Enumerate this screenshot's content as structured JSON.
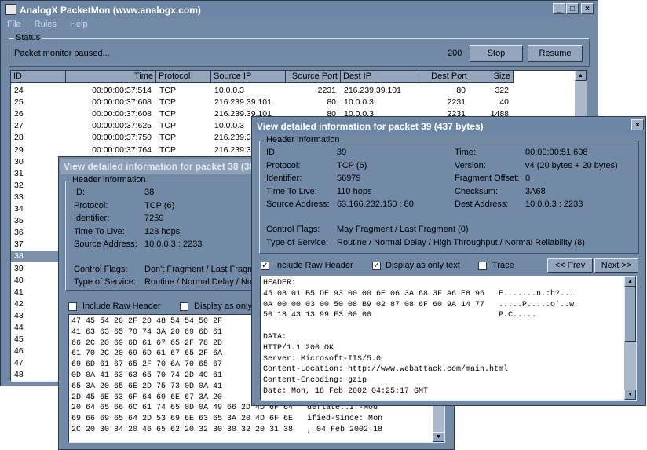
{
  "main": {
    "title": "AnalogX PacketMon (www.analogx.com)",
    "menu": [
      "File",
      "Rules",
      "Help"
    ],
    "status_label": "Status",
    "status_text": "Packet monitor paused...",
    "count": "200",
    "stop": "Stop",
    "resume": "Resume",
    "columns": [
      "ID",
      "Time",
      "Protocol",
      "Source IP",
      "Source Port",
      "Dest IP",
      "Dest Port",
      "Size"
    ],
    "rows": [
      [
        "24",
        "00:00:00:37:514",
        "TCP",
        "10.0.0.3",
        "2231",
        "216.239.39.101",
        "80",
        "322"
      ],
      [
        "25",
        "00:00:00:37:608",
        "TCP",
        "216.239.39.101",
        "80",
        "10.0.0.3",
        "2231",
        "40"
      ],
      [
        "26",
        "00:00:00:37:608",
        "TCP",
        "216.239.39.101",
        "80",
        "10.0.0.3",
        "2231",
        "1488"
      ],
      [
        "27",
        "00:00:00:37:625",
        "TCP",
        "10.0.0.3",
        "",
        "",
        "",
        ""
      ],
      [
        "28",
        "00:00:00:37:750",
        "TCP",
        "216.239.3",
        "",
        "",
        "",
        ""
      ],
      [
        "29",
        "00:00:00:37:764",
        "TCP",
        "216.239.3",
        "",
        "",
        "",
        ""
      ],
      [
        "30",
        "",
        "",
        "",
        "",
        "",
        "",
        ""
      ],
      [
        "31",
        "",
        "",
        "",
        "",
        "",
        "",
        ""
      ],
      [
        "32",
        "",
        "",
        "",
        "",
        "",
        "",
        ""
      ],
      [
        "33",
        "",
        "",
        "",
        "",
        "",
        "",
        ""
      ],
      [
        "34",
        "",
        "",
        "",
        "",
        "",
        "",
        ""
      ],
      [
        "35",
        "",
        "",
        "",
        "",
        "",
        "",
        ""
      ],
      [
        "36",
        "",
        "",
        "",
        "",
        "",
        "",
        ""
      ],
      [
        "37",
        "",
        "",
        "",
        "",
        "",
        "",
        ""
      ],
      [
        "38",
        "",
        "",
        "",
        "",
        "",
        "",
        ""
      ],
      [
        "39",
        "",
        "",
        "",
        "",
        "",
        "",
        ""
      ],
      [
        "40",
        "",
        "",
        "",
        "",
        "",
        "",
        ""
      ],
      [
        "41",
        "",
        "",
        "",
        "",
        "",
        "",
        ""
      ],
      [
        "42",
        "",
        "",
        "",
        "",
        "",
        "",
        ""
      ],
      [
        "43",
        "",
        "",
        "",
        "",
        "",
        "",
        ""
      ],
      [
        "44",
        "",
        "",
        "",
        "",
        "",
        "",
        ""
      ],
      [
        "45",
        "",
        "",
        "",
        "",
        "",
        "",
        ""
      ],
      [
        "46",
        "",
        "",
        "",
        "",
        "",
        "",
        ""
      ],
      [
        "47",
        "",
        "",
        "",
        "",
        "",
        "",
        ""
      ],
      [
        "48",
        "",
        "",
        "",
        "",
        "",
        "",
        ""
      ]
    ],
    "selected_row": "38"
  },
  "win38": {
    "title": "View detailed information for packet 38 (38",
    "group": "Header information",
    "fields": [
      {
        "k": "ID:",
        "v": "38"
      },
      {
        "k": "Protocol:",
        "v": "TCP (6)"
      },
      {
        "k": "Identifier:",
        "v": "7259"
      },
      {
        "k": "Time To Live:",
        "v": "128 hops"
      },
      {
        "k": "Source Address:",
        "v": "10.0.0.3 : 2233"
      }
    ],
    "control_flags_k": "Control Flags:",
    "control_flags_v": "Don't Fragment / Last Fragme",
    "tos_k": "Type of Service:",
    "tos_v": "Routine / Normal Delay / No",
    "include_raw": "Include Raw Header",
    "display_text": "Display as only",
    "raw": "47 45 54 20 2F 20 48 54 54 50 2F\n41 63 63 65 70 74 3A 20 69 6D 61\n66 2C 20 69 6D 61 67 65 2F 78 2D\n61 70 2C 20 69 6D 61 67 65 2F 6A\n69 6D 61 67 65 2F 70 6A 70 65 67\n0D 0A 41 63 63 65 70 74 2D 4C 61\n65 3A 20 65 6E 2D 75 73 0D 0A 41\n2D 45 6E 63 6F 64 69 6E 67 3A 20\n20 64 65 66 6C 61 74 65 0D 0A 49 66 2D 4D 6F 64   deflate..If-Mod\n69 66 69 65 64 2D 53 69 6E 63 65 3A 20 4D 6F 6E   ified-Since: Mon\n2C 20 30 34 20 46 65 62 20 32 30 30 32 20 31 38   , 04 Feb 2002 18"
  },
  "win39": {
    "title": "View detailed information for packet 39 (437 bytes)",
    "group": "Header information",
    "left": [
      {
        "k": "ID:",
        "v": "39"
      },
      {
        "k": "Protocol:",
        "v": "TCP (6)"
      },
      {
        "k": "Identifier:",
        "v": "56979"
      },
      {
        "k": "Time To Live:",
        "v": "110 hops"
      },
      {
        "k": "Source Address:",
        "v": "63.166.232.150 : 80"
      }
    ],
    "right": [
      {
        "k": "Time:",
        "v": "00:00:00:51:608"
      },
      {
        "k": "Version:",
        "v": "v4 (20 bytes + 20 bytes)"
      },
      {
        "k": "Fragment Offset:",
        "v": "0"
      },
      {
        "k": "Checksum:",
        "v": "3A68"
      },
      {
        "k": "Dest Address:",
        "v": "10.0.0.3 : 2233"
      }
    ],
    "control_flags_k": "Control Flags:",
    "control_flags_v": "May Fragment / Last Fragment (0)",
    "tos_k": "Type of Service:",
    "tos_v": "Routine / Normal Delay / High Throughput / Normal Reliability (8)",
    "include_raw": "Include Raw Header",
    "display_text": "Display as only text",
    "trace": "Trace",
    "prev": "<< Prev",
    "next": "Next >>",
    "raw": "HEADER:\n45 08 01 B5 DE 93 00 00 6E 06 3A 68 3F A6 E8 96   E.......n.:h?...\n0A 00 00 03 00 50 08 B9 02 87 08 6F 60 9A 14 77   .....P.....o`..w\n50 18 43 13 99 F3 00 00                           P.C.....\n\nDATA:\nHTTP/1.1 200 OK\nServer: Microsoft-IIS/5.0\nContent-Location: http://www.webattack.com/main.html\nContent-Encoding: gzip\nDate: Mon, 18 Feb 2002 04:25:17 GMT"
  }
}
